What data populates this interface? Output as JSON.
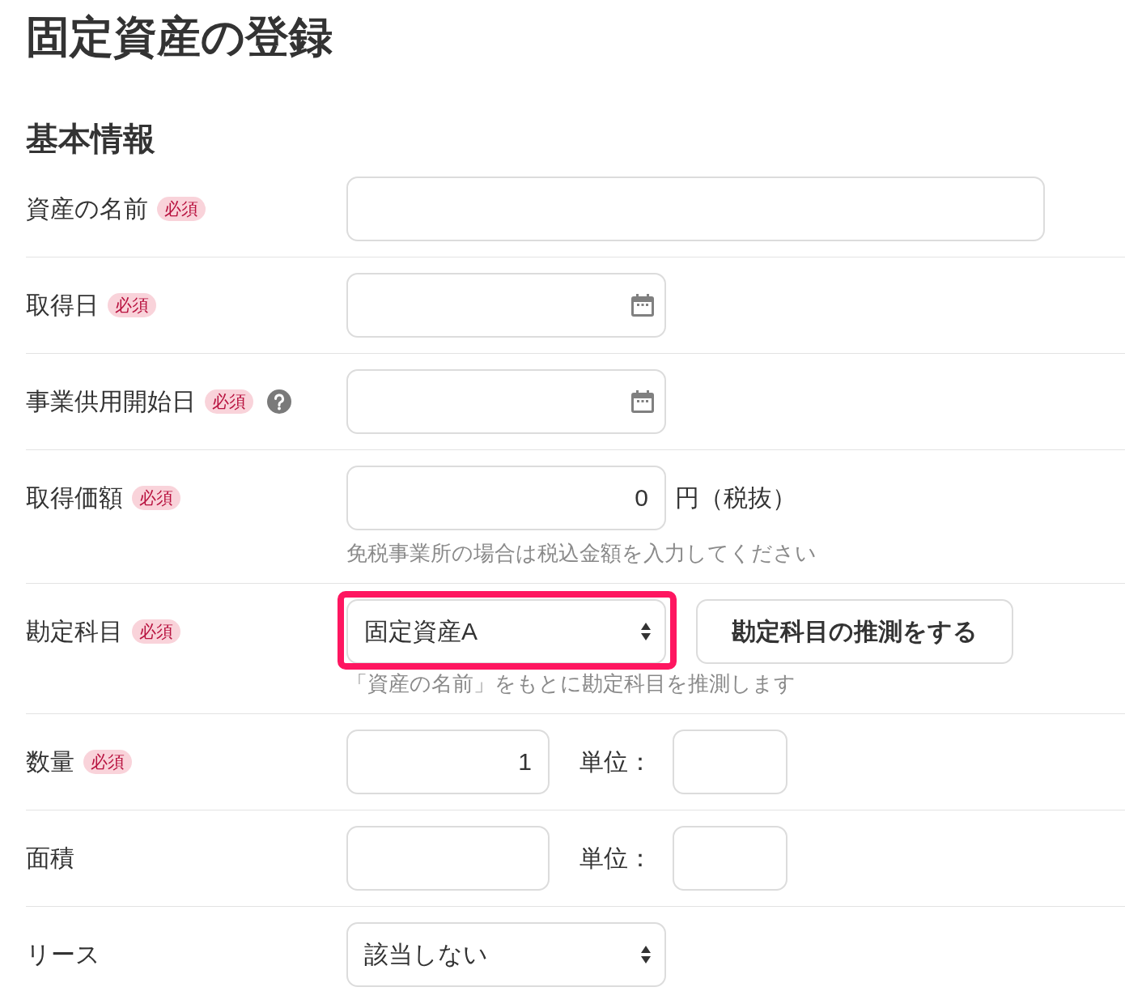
{
  "title": "固定資産の登録",
  "section": {
    "heading": "基本情報"
  },
  "rows": [
    {
      "kind": "text",
      "label": "資産の名前",
      "badge": "必須",
      "help": false
    },
    {
      "kind": "date",
      "label": "取得日",
      "badge": "必須",
      "help": false
    },
    {
      "kind": "date",
      "label": "事業供用開始日",
      "badge": "必須",
      "help": true
    },
    {
      "kind": "amount",
      "label": "取得価額",
      "badge": "必須",
      "help": false,
      "value": "0",
      "suffix": "円（税抜）",
      "note": "免税事業所の場合は税込金額を入力してください"
    },
    {
      "kind": "select",
      "label": "勘定科目",
      "badge": "必須",
      "help": false,
      "value": "固定資産A",
      "highlighted": true,
      "button": "勘定科目の推測をする",
      "note": "「資産の名前」をもとに勘定科目を推測します"
    },
    {
      "kind": "measure",
      "label": "数量",
      "badge": "必須",
      "help": false,
      "value": "1",
      "unit_label": "単位："
    },
    {
      "kind": "measure",
      "label": "面積",
      "help": false,
      "unit_label": "単位："
    },
    {
      "kind": "select",
      "label": "リース",
      "help": false,
      "value": "該当しない",
      "highlighted": false
    }
  ]
}
